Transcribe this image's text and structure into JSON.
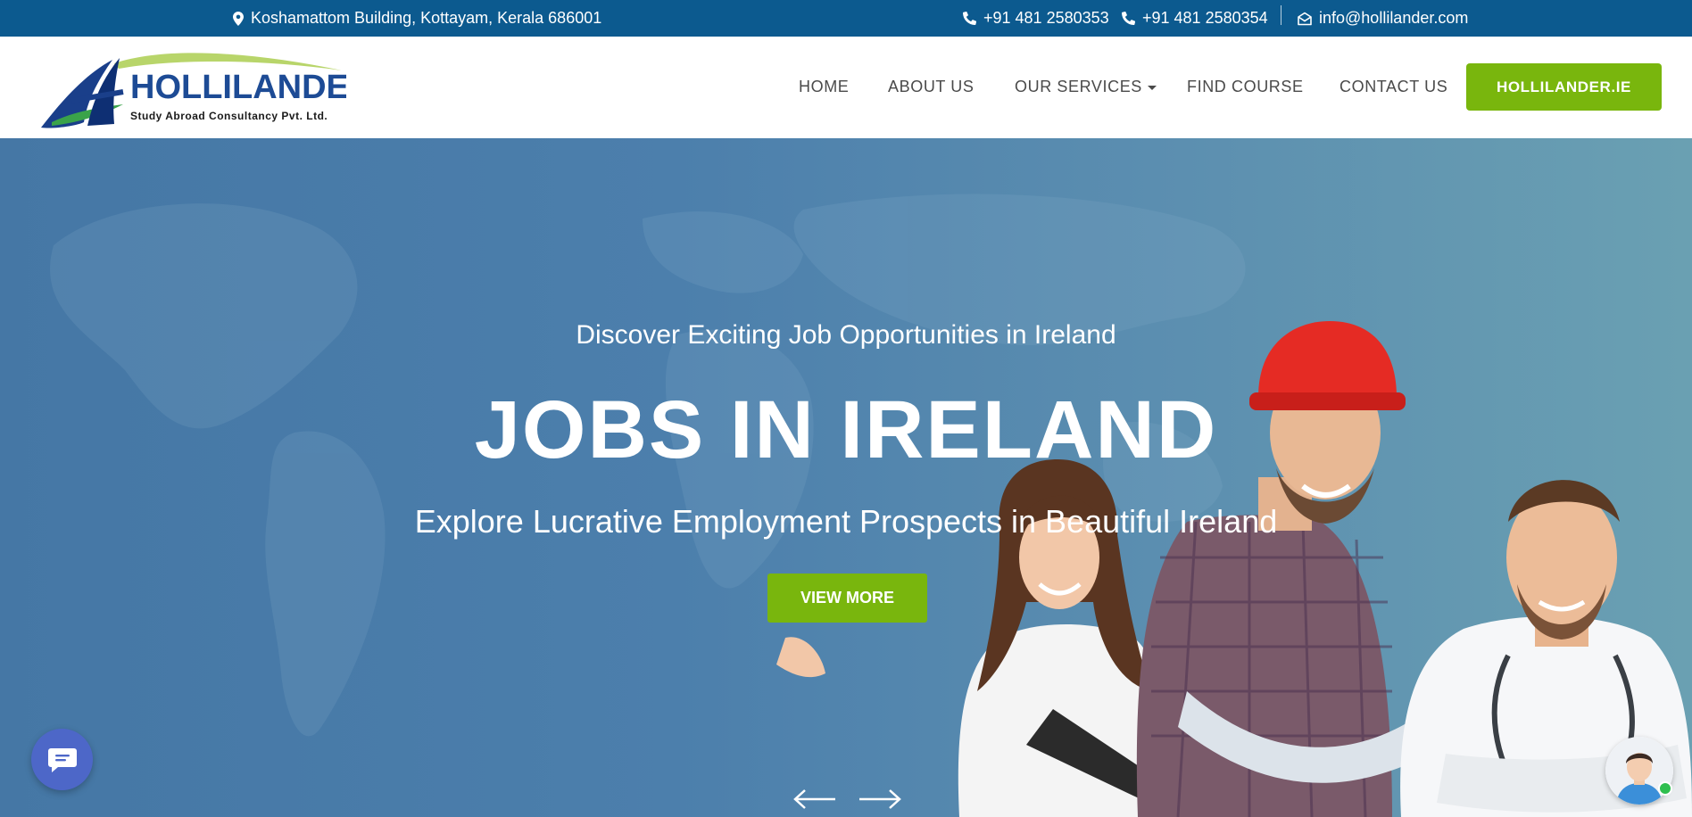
{
  "topbar": {
    "address": "Koshamattom Building, Kottayam, Kerala 686001",
    "phone1": "+91 481 2580353",
    "phone2": "+91 481 2580354",
    "email": "info@hollilander.com",
    "icons": [
      "map-pin-icon",
      "phone-icon",
      "envelope-icon"
    ],
    "background_color": "#0c5a8f"
  },
  "logo": {
    "brand": "HOLLILANDER",
    "tagline": "Study Abroad Consultancy Pvt. Ltd."
  },
  "nav": {
    "items": [
      "HOME",
      "ABOUT US",
      "OUR SERVICES",
      "FIND COURSE",
      "CONTACT US"
    ],
    "cta": "HOLLILANDER.IE",
    "cta_color": "#79b60d"
  },
  "hero": {
    "subtitle": "Discover Exciting Job Opportunities in Ireland",
    "title": "JOBS IN IRELAND",
    "description": "Explore Lucrative Employment Prospects in Beautiful Ireland",
    "button": "VIEW MORE"
  }
}
